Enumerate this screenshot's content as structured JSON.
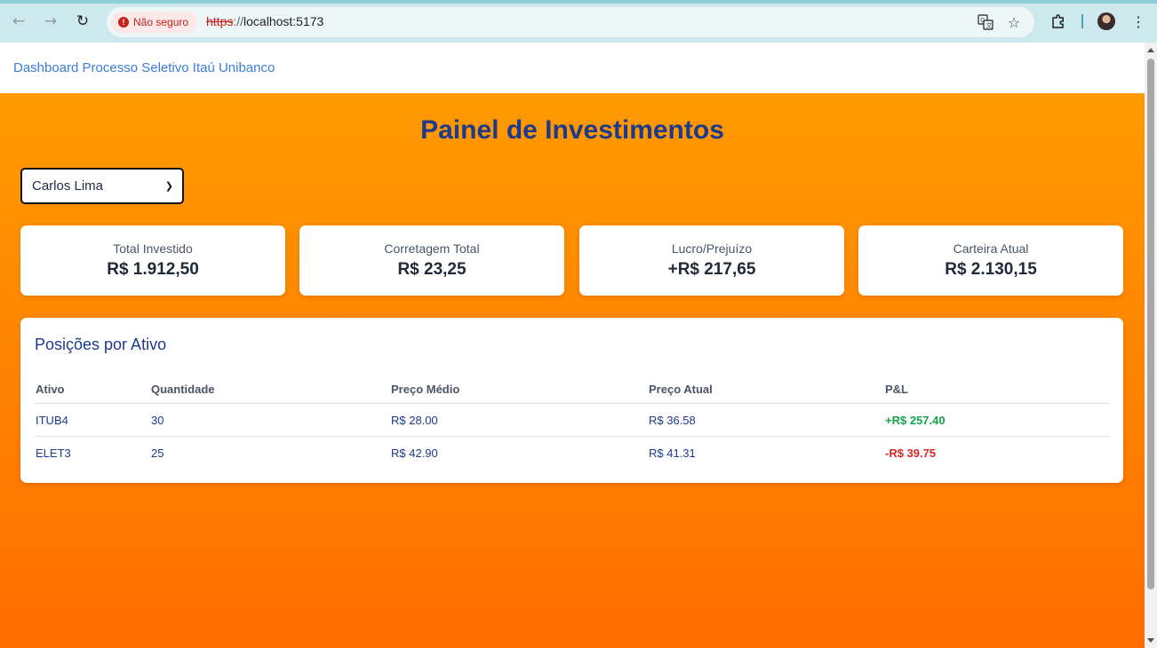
{
  "browser": {
    "security_label": "Não seguro",
    "url_scheme": "https",
    "url_sep": "://",
    "url_host": "localhost:5173",
    "icons": [
      "back-icon",
      "forward-icon",
      "reload-icon",
      "translate-icon",
      "bookmark-star-icon",
      "extensions-icon",
      "profile-avatar",
      "more-vert-icon"
    ]
  },
  "header": {
    "brand": "Dashboard Processo Seletivo Itaú Unibanco"
  },
  "main": {
    "title": "Painel de Investimentos",
    "client_select": {
      "value": "Carlos Lima"
    },
    "cards": [
      {
        "label": "Total Investido",
        "value": "R$ 1.912,50"
      },
      {
        "label": "Corretagem Total",
        "value": "R$ 23,25"
      },
      {
        "label": "Lucro/Prejuízo",
        "value": "+R$ 217,65"
      },
      {
        "label": "Carteira Atual",
        "value": "R$ 2.130,15"
      }
    ],
    "positions": {
      "title": "Posições por Ativo",
      "columns": [
        "Ativo",
        "Quantidade",
        "Preço Médio",
        "Preço Atual",
        "P&L"
      ],
      "rows": [
        [
          "ITUB4",
          "30",
          "R$ 28.00",
          "R$ 36.58",
          "+R$ 257.40"
        ],
        [
          "ELET3",
          "25",
          "R$ 42.90",
          "R$ 41.31",
          "-R$ 39.75"
        ]
      ]
    }
  },
  "colors": {
    "gradient_top": "#ff9a00",
    "gradient_bottom": "#ff6d00",
    "title": "#1e3a8a",
    "brand_link": "#3b7ddd",
    "gain": "#16a34a",
    "loss": "#dc2626"
  }
}
